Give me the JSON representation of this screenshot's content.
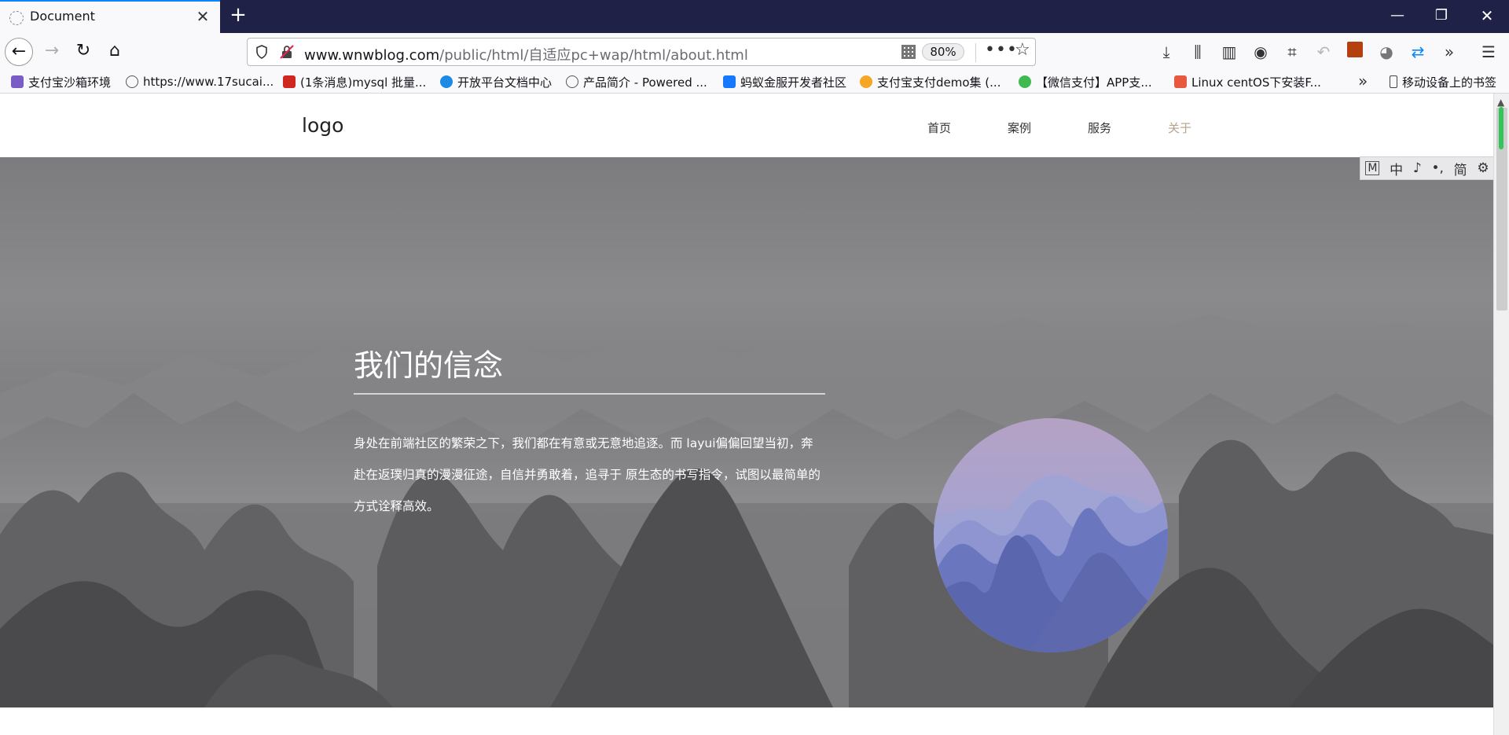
{
  "browser": {
    "tab_title": "Document",
    "url_host_part": "www.wnwblog.com",
    "url_path_part": "/public/html/自适应pc+wap/html/about.html",
    "zoom": "80%"
  },
  "bookmarks": [
    {
      "label": "支付宝沙箱环境",
      "icon_color": "#7a5cc7"
    },
    {
      "label": "https://www.17sucai...",
      "icon_color": "#555555"
    },
    {
      "label": "(1条消息)mysql 批量...",
      "icon_color": "#d0281e"
    },
    {
      "label": "开放平台文档中心",
      "icon_color": "#1e88e5"
    },
    {
      "label": "产品简介 - Powered ...",
      "icon_color": "#555555"
    },
    {
      "label": "蚂蚁金服开发者社区",
      "icon_color": "#1677ff"
    },
    {
      "label": "支付宝支付demo集 (...",
      "icon_color": "#f5a623"
    },
    {
      "label": "【微信支付】APP支...",
      "icon_color": "#3fb950"
    },
    {
      "label": "Linux centOS下安装F...",
      "icon_color": "#e8573f"
    },
    {
      "label": "移动设备上的书签",
      "icon_color": "#555555"
    }
  ],
  "site": {
    "logo": "logo",
    "menu": [
      "首页",
      "案例",
      "服务",
      "关于"
    ],
    "active_menu": "关于",
    "active_color": "#b8a28a"
  },
  "hero": {
    "title": "我们的信念",
    "text": "身处在前端社区的繁荣之下，我们都在有意或无意地追逐。而 layui偏偏回望当初，奔赴在返璞归真的漫漫征途，自信并勇敢着，追寻于 原生态的书写指令，试图以最简单的方式诠释高效。"
  },
  "ime_bar": {
    "items": [
      "M",
      "中",
      "♪",
      "•,",
      "简",
      "⚙"
    ]
  }
}
